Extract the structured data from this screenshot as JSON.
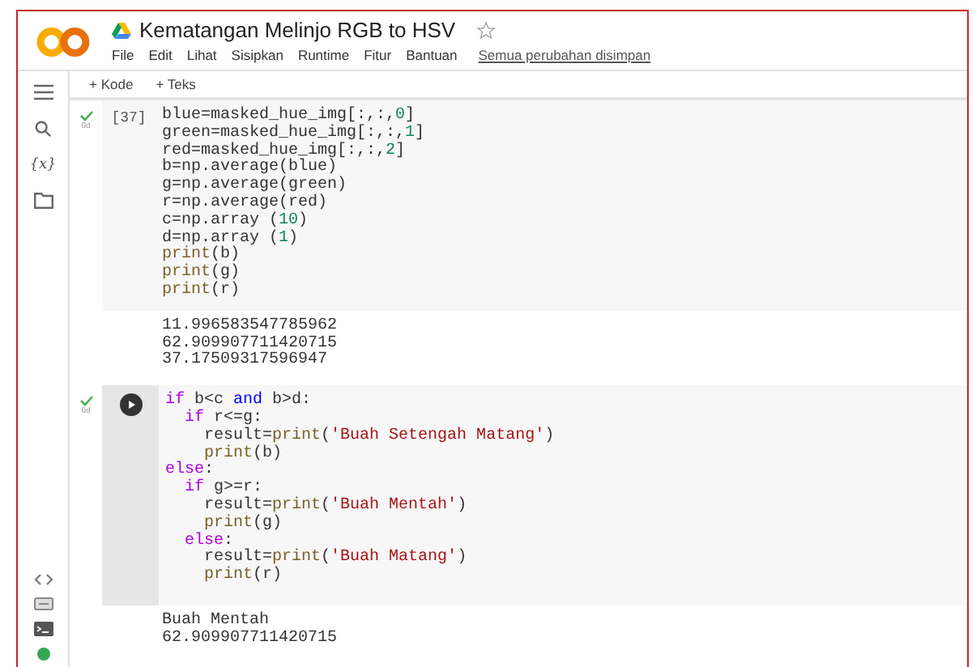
{
  "header": {
    "title": "Kematangan Melinjo RGB to HSV",
    "starred": false,
    "menu": [
      "File",
      "Edit",
      "Lihat",
      "Sisipkan",
      "Runtime",
      "Fitur",
      "Bantuan"
    ],
    "save_status": "Semua perubahan disimpan"
  },
  "toolbar": [
    "+ Kode",
    "+ Teks"
  ],
  "sidebar": {
    "variables_label": "{x}"
  },
  "cells": [
    {
      "kind": "done",
      "count": "[37]",
      "duration": "0d",
      "lines": [
        [
          {
            "t": "blue=masked_hue_img[:,:,",
            "kind": "plain"
          },
          {
            "t": "0",
            "kind": "number"
          },
          {
            "t": "]",
            "kind": "plain"
          }
        ],
        [
          {
            "t": "green=masked_hue_img[:,:,",
            "kind": "plain"
          },
          {
            "t": "1",
            "kind": "number"
          },
          {
            "t": "]",
            "kind": "plain"
          }
        ],
        [
          {
            "t": "red=masked_hue_img[:,:,",
            "kind": "plain"
          },
          {
            "t": "2",
            "kind": "number"
          },
          {
            "t": "]",
            "kind": "plain"
          }
        ],
        [
          {
            "t": "b=np.average(blue)",
            "kind": "plain"
          }
        ],
        [
          {
            "t": "g=np.average(green)",
            "kind": "plain"
          }
        ],
        [
          {
            "t": "r=np.average(red)",
            "kind": "plain"
          }
        ],
        [
          {
            "t": "c=np.array (",
            "kind": "plain"
          },
          {
            "t": "10",
            "kind": "number"
          },
          {
            "t": ")",
            "kind": "plain"
          }
        ],
        [
          {
            "t": "d=np.array (",
            "kind": "plain"
          },
          {
            "t": "1",
            "kind": "number"
          },
          {
            "t": ")",
            "kind": "plain"
          }
        ],
        [
          {
            "t": "print",
            "kind": "function"
          },
          {
            "t": "(b)",
            "kind": "plain"
          }
        ],
        [
          {
            "t": "print",
            "kind": "function"
          },
          {
            "t": "(g)",
            "kind": "plain"
          }
        ],
        [
          {
            "t": "print",
            "kind": "function"
          },
          {
            "t": "(r)",
            "kind": "plain"
          }
        ]
      ],
      "output": [
        "11.996583547785962",
        "62.909907711420715",
        "37.17509317596947"
      ]
    },
    {
      "kind": "run",
      "duration": "0d",
      "lines": [
        [
          {
            "t": "if",
            "kind": "keyword"
          },
          {
            "t": " b<c ",
            "kind": "plain"
          },
          {
            "t": "and",
            "kind": "operator"
          },
          {
            "t": " b>d:",
            "kind": "plain"
          }
        ],
        [
          {
            "t": "  if",
            "kind": "keyword"
          },
          {
            "t": " r<=g:",
            "kind": "plain"
          }
        ],
        [
          {
            "t": "    result=",
            "kind": "plain"
          },
          {
            "t": "print",
            "kind": "function"
          },
          {
            "t": "(",
            "kind": "plain"
          },
          {
            "t": "'Buah Setengah Matang'",
            "kind": "string"
          },
          {
            "t": ")",
            "kind": "plain"
          }
        ],
        [
          {
            "t": "    print",
            "kind": "function"
          },
          {
            "t": "(b)",
            "kind": "plain"
          }
        ],
        [
          {
            "t": "else",
            "kind": "keyword"
          },
          {
            "t": ":",
            "kind": "plain"
          }
        ],
        [
          {
            "t": "  if",
            "kind": "keyword"
          },
          {
            "t": " g>=r:",
            "kind": "plain"
          }
        ],
        [
          {
            "t": "    result=",
            "kind": "plain"
          },
          {
            "t": "print",
            "kind": "function"
          },
          {
            "t": "(",
            "kind": "plain"
          },
          {
            "t": "'Buah Mentah'",
            "kind": "string"
          },
          {
            "t": ")",
            "kind": "plain"
          }
        ],
        [
          {
            "t": "    print",
            "kind": "function"
          },
          {
            "t": "(g)",
            "kind": "plain"
          }
        ],
        [
          {
            "t": "  else",
            "kind": "keyword"
          },
          {
            "t": ":",
            "kind": "plain"
          }
        ],
        [
          {
            "t": "    result=",
            "kind": "plain"
          },
          {
            "t": "print",
            "kind": "function"
          },
          {
            "t": "(",
            "kind": "plain"
          },
          {
            "t": "'Buah Matang'",
            "kind": "string"
          },
          {
            "t": ")",
            "kind": "plain"
          }
        ],
        [
          {
            "t": "    print",
            "kind": "function"
          },
          {
            "t": "(r)",
            "kind": "plain"
          }
        ]
      ],
      "output": [
        "Buah Mentah",
        "62.909907711420715"
      ]
    }
  ]
}
